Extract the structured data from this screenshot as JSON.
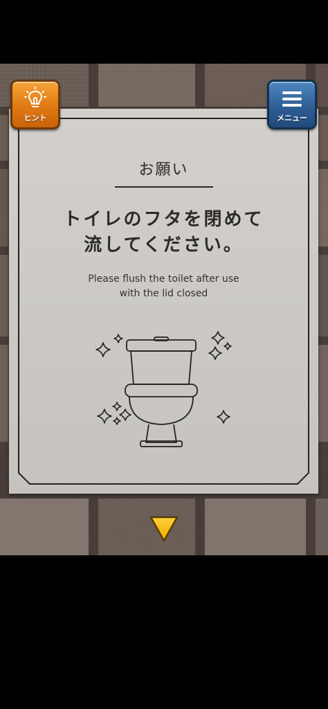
{
  "buttons": {
    "hint": {
      "label": "ヒント",
      "icon": "lightbulb-icon",
      "color": "#e88a1e"
    },
    "menu": {
      "label": "メニュー",
      "icon": "hamburger-menu-icon",
      "color": "#336aa4"
    }
  },
  "sign": {
    "title": "お願い",
    "main_lines": [
      "トイレのフタを閉めて",
      "流してください。"
    ],
    "english_lines": [
      "Please flush the toilet after use",
      "with the lid closed"
    ],
    "illustration": "toilet-icon"
  },
  "navigation": {
    "down_arrow": {
      "icon": "down-arrow-icon",
      "color": "#f5b800"
    }
  },
  "colors": {
    "wall": "#5b4f48",
    "sign": "#cfccc8",
    "ink": "#2a2a2a"
  }
}
